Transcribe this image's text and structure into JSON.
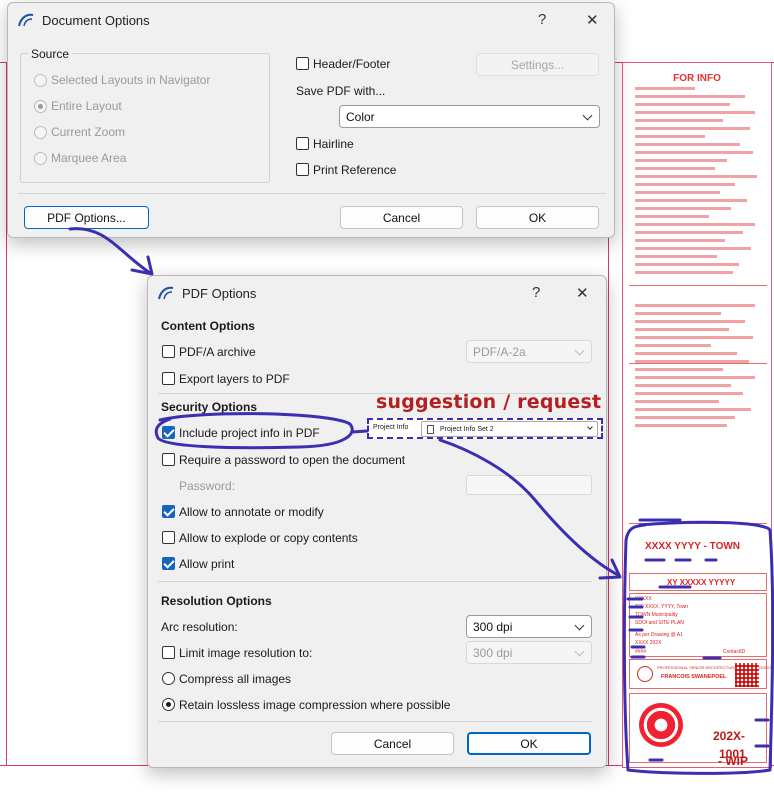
{
  "document_options": {
    "title": "Document Options",
    "help": "?",
    "close": "✕",
    "source": {
      "label": "Source",
      "options": [
        "Selected Layouts in Navigator",
        "Entire Layout",
        "Current Zoom",
        "Marquee Area"
      ],
      "selected": "Entire Layout"
    },
    "header_footer": "Header/Footer",
    "settings_button": "Settings...",
    "save_pdf_with": "Save PDF with...",
    "color_select": "Color",
    "hairline": "Hairline",
    "print_reference": "Print Reference",
    "pdf_options_button": "PDF Options...",
    "cancel": "Cancel",
    "ok": "OK"
  },
  "pdf_options": {
    "title": "PDF Options",
    "help": "?",
    "close": "✕",
    "content_options": {
      "heading": "Content Options",
      "pdfa_archive": "PDF/A archive",
      "pdfa_select": "PDF/A-2a",
      "export_layers": "Export layers to PDF"
    },
    "security_options": {
      "heading": "Security Options",
      "include_project_info": "Include project info in PDF",
      "require_password": "Require a password to open the document",
      "password_label": "Password:",
      "allow_annotate": "Allow to annotate or modify",
      "allow_explode": "Allow to explode or copy contents",
      "allow_print": "Allow print"
    },
    "resolution_options": {
      "heading": "Resolution Options",
      "arc_resolution_label": "Arc resolution:",
      "arc_resolution_value": "300 dpi",
      "limit_image_label": "Limit image resolution to:",
      "limit_image_value": "300 dpi",
      "compress_all": "Compress all images",
      "retain_lossless": "Retain lossless image compression where possible"
    },
    "cancel": "Cancel",
    "ok": "OK"
  },
  "annotation": {
    "suggestion": "suggestion / request",
    "project_info_label": "Project Info",
    "project_info_value": "Project Info Set 2"
  },
  "title_block": {
    "for_info": "FOR INFO",
    "town": "XXXX YYYY - TOWN",
    "xy": "XY XXXXX YYYYY",
    "line1": "XXXXX",
    "line2": "T30 XXXX, YYYY, Town",
    "line3": "TOWN Municipality",
    "line4": "SDOI and SITE PLAN",
    "line5": "As per Drawing @ A1",
    "line6": "XXXX 202X",
    "line7": "####",
    "contact": "ContactID",
    "firm": "FRANCOIS SWANEPOEL",
    "firm_small": "PROFESSIONAL SENIOR ARCHITECTURAL TECHNOLOGIST",
    "year": "202X-",
    "number": "1001",
    "wip": "- WIP"
  },
  "colors": {
    "accent": "#0067c0",
    "annotation_ink": "#3a2fb0",
    "suggestion_text": "#b51f1f",
    "title_block_red": "#d22222"
  }
}
